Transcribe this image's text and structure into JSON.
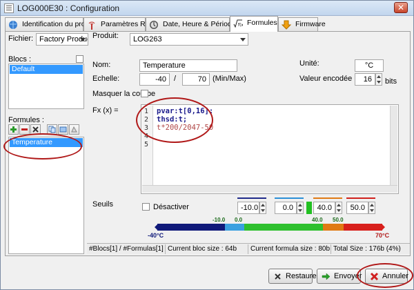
{
  "window": {
    "title": "LOG000E30 : Configuration",
    "close_label": "✕"
  },
  "tabs": [
    {
      "label": "Identification du produit"
    },
    {
      "label": "Paramètres RF"
    },
    {
      "label": "Date, Heure & Périodes"
    },
    {
      "label": "Formules"
    },
    {
      "label": "Firmware"
    }
  ],
  "top": {
    "fichier_label": "Fichier:",
    "fichier_value": "Factory Product",
    "produit_label": "Produit:",
    "produit_value": "LOG263"
  },
  "blocs": {
    "label": "Blocs :",
    "items": [
      "Default"
    ]
  },
  "formules": {
    "label": "Formules :",
    "items": [
      "Temperature"
    ]
  },
  "form": {
    "nom_label": "Nom:",
    "nom_value": "Temperature",
    "unite_label": "Unité:",
    "unite_value": "°C",
    "echelle_label": "Echelle:",
    "echelle_min": "-40",
    "echelle_sep": "/",
    "echelle_max": "70",
    "echelle_hint": "(Min/Max)",
    "valeur_label": "Valeur encodée",
    "valeur_value": "16",
    "valeur_unit": "bits",
    "masquer_label": "Masquer la courbe",
    "fx_label": "Fx (x) ="
  },
  "editor": {
    "lines": [
      {
        "num": "1",
        "text": "pvar:t[0,16];",
        "style": "blue"
      },
      {
        "num": "2",
        "text": "thsd:t;",
        "style": "blue"
      },
      {
        "num": "3",
        "text": "t*200/2047-50",
        "style": "gray"
      },
      {
        "num": "4",
        "text": "",
        "style": ""
      },
      {
        "num": "5",
        "text": "",
        "style": ""
      }
    ]
  },
  "seuils": {
    "label": "Seuils",
    "desactiver_label": "Désactiver",
    "values": [
      "-10.0",
      "0.0",
      "40.0",
      "50.0"
    ],
    "colors": [
      "#1f2a8a",
      "#2a8fd6",
      "#e07a14",
      "#d0201c"
    ],
    "bar_ticks": [
      "-10.0",
      "0.0",
      "40.0",
      "50.0"
    ],
    "min_label": "-40°C",
    "max_label": "70°C"
  },
  "status": {
    "cells": [
      "#Blocs[1] / #Formulas[1]",
      "Current bloc size : 64b",
      "Current formula size : 80b",
      "Total Size : 176b (4%)"
    ]
  },
  "buttons": {
    "restaurer": "Restaurer",
    "envoyer": "Envoyer",
    "annuler": "Annuler"
  },
  "colors": {
    "accent": "#3399ff",
    "annotation_ring": "#b01818"
  }
}
